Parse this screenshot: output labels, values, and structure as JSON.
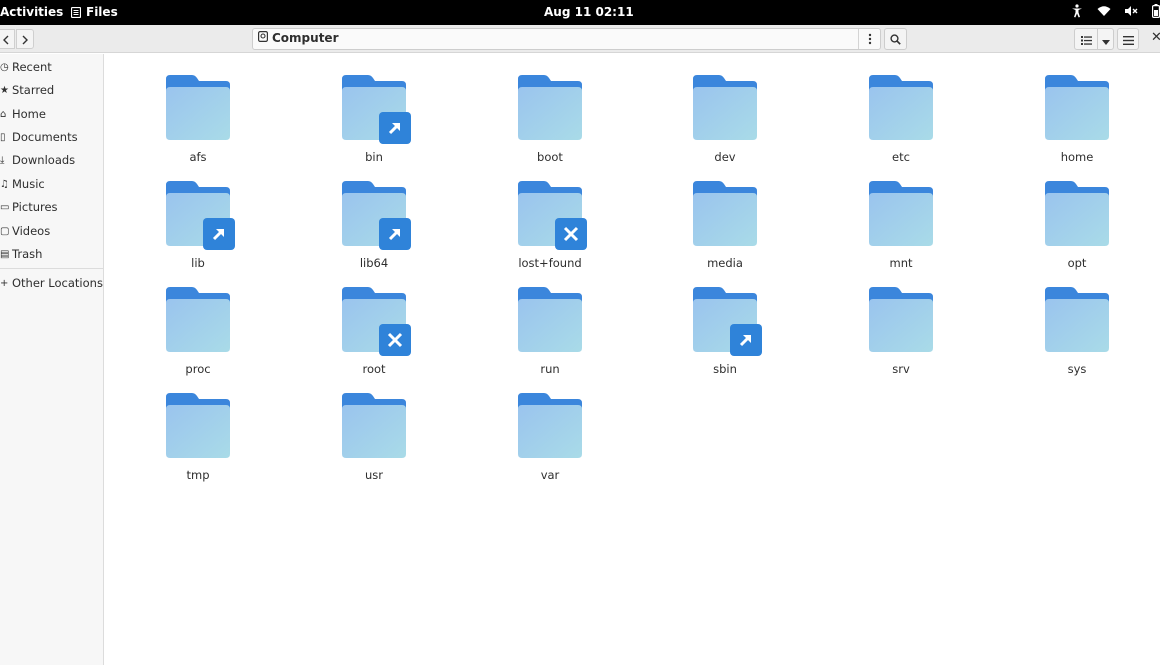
{
  "topbar": {
    "activities": "Activities",
    "app_name": "Files",
    "clock": "Aug 11  02:11",
    "tray_icons": [
      "accessibility-icon",
      "wifi-icon",
      "volume-muted-icon",
      "battery-icon"
    ]
  },
  "headerbar": {
    "location": "Computer",
    "icons": [
      "back-icon",
      "forward-icon",
      "drive-icon",
      "more-vert-icon",
      "search-icon",
      "list-view-icon",
      "chevron-down-icon",
      "hamburger-menu-icon",
      "close-icon"
    ]
  },
  "sidebar": {
    "items": [
      {
        "label": "Recent",
        "icon": "clock-icon"
      },
      {
        "label": "Starred",
        "icon": "star-icon"
      },
      {
        "label": "Home",
        "icon": "home-icon"
      },
      {
        "label": "Documents",
        "icon": "document-icon"
      },
      {
        "label": "Downloads",
        "icon": "download-icon"
      },
      {
        "label": "Music",
        "icon": "music-icon"
      },
      {
        "label": "Pictures",
        "icon": "picture-icon"
      },
      {
        "label": "Videos",
        "icon": "video-icon"
      },
      {
        "label": "Trash",
        "icon": "trash-icon"
      }
    ],
    "other_locations": {
      "label": "Other Locations",
      "icon": "plus-icon"
    }
  },
  "folders": [
    {
      "name": "afs",
      "emblem": "none"
    },
    {
      "name": "bin",
      "emblem": "symlink"
    },
    {
      "name": "boot",
      "emblem": "none"
    },
    {
      "name": "dev",
      "emblem": "none"
    },
    {
      "name": "etc",
      "emblem": "none"
    },
    {
      "name": "home",
      "emblem": "none"
    },
    {
      "name": "lib",
      "emblem": "symlink"
    },
    {
      "name": "lib64",
      "emblem": "symlink"
    },
    {
      "name": "lost+found",
      "emblem": "unreadable"
    },
    {
      "name": "media",
      "emblem": "none"
    },
    {
      "name": "mnt",
      "emblem": "none"
    },
    {
      "name": "opt",
      "emblem": "none"
    },
    {
      "name": "proc",
      "emblem": "none"
    },
    {
      "name": "root",
      "emblem": "unreadable"
    },
    {
      "name": "run",
      "emblem": "none"
    },
    {
      "name": "sbin",
      "emblem": "symlink"
    },
    {
      "name": "srv",
      "emblem": "none"
    },
    {
      "name": "sys",
      "emblem": "none"
    },
    {
      "name": "tmp",
      "emblem": "none"
    },
    {
      "name": "usr",
      "emblem": "none"
    },
    {
      "name": "var",
      "emblem": "none"
    }
  ],
  "colors": {
    "folder_back": "#3b86dc",
    "folder_front_top": "#9ac4ee",
    "folder_front_bottom": "#a9dbe8",
    "emblem": "#2f83d9"
  }
}
